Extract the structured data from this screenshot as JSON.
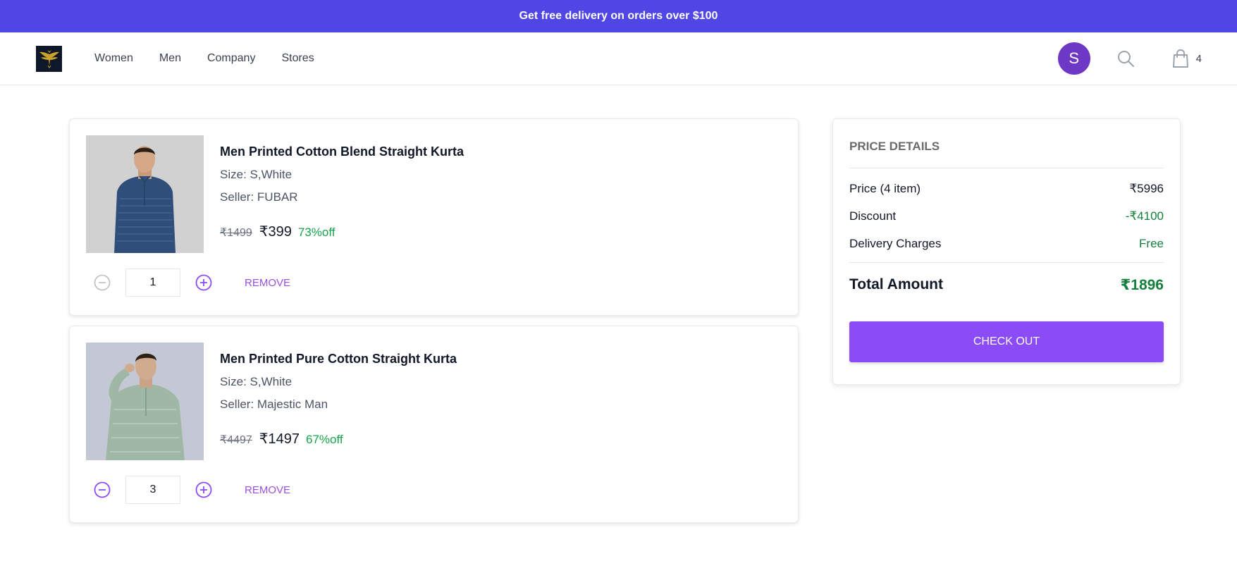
{
  "promo": {
    "text": "Get free delivery on orders over $100"
  },
  "nav": {
    "links": [
      "Women",
      "Men",
      "Company",
      "Stores"
    ],
    "avatar_initial": "S",
    "cart_count": "4"
  },
  "cart": {
    "items": [
      {
        "name": "Men Printed Cotton Blend Straight Kurta",
        "size": "Size: S,White",
        "seller": "Seller: FUBAR",
        "original_price": "₹1499",
        "price": "₹399",
        "discount": "73%off",
        "quantity": "1",
        "remove_label": "REMOVE"
      },
      {
        "name": "Men Printed Pure Cotton Straight Kurta",
        "size": "Size: S,White",
        "seller": "Seller: Majestic Man",
        "original_price": "₹4497",
        "price": "₹1497",
        "discount": "67%off",
        "quantity": "3",
        "remove_label": "REMOVE"
      }
    ]
  },
  "summary": {
    "title": "PRICE DETAILS",
    "price_label": "Price (4 item)",
    "price_value": "₹5996",
    "discount_label": "Discount",
    "discount_value": "-₹4100",
    "delivery_label": "Delivery Charges",
    "delivery_value": "Free",
    "total_label": "Total Amount",
    "total_value": "₹1896",
    "checkout_label": "CHECK OUT"
  },
  "colors": {
    "brand": "#4f46e5",
    "accent": "#8b4cf7",
    "green": "#16a34a"
  }
}
